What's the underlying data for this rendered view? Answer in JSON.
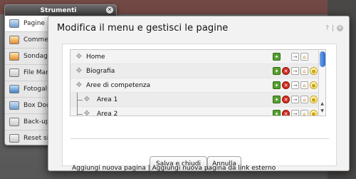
{
  "tools_window": {
    "title": "Strumenti",
    "items": [
      {
        "label": "Pagine",
        "icon": "pages-icon"
      },
      {
        "label": "Commenti",
        "icon": "comments-icon"
      },
      {
        "label": "Sondaggi",
        "icon": "polls-icon"
      },
      {
        "label": "File Manager",
        "icon": "file-manager-icon"
      },
      {
        "label": "Fotogallery",
        "icon": "photo-gallery-icon"
      },
      {
        "label": "Box Documenti",
        "icon": "documents-box-icon"
      },
      {
        "label": "Back-up e",
        "icon": "backup-icon"
      },
      {
        "label": "Reset sito",
        "icon": "reset-icon"
      }
    ]
  },
  "modal": {
    "title": "Modifica il menu e gestisci le pagine",
    "help": "?",
    "tree": [
      {
        "label": "Home",
        "level": 0
      },
      {
        "label": "Biografia",
        "level": 0
      },
      {
        "label": "Aree di competenza",
        "level": 0
      },
      {
        "label": "Area 1",
        "level": 1
      },
      {
        "label": "Area 2",
        "level": 1
      }
    ],
    "save_button": "Salva e chiudi",
    "cancel_button": "Annulla",
    "add_page_link": "Aggiungi nuova pagina",
    "link_separator": "|",
    "add_external_link": "Aggiungi nuova pagina da link esterno"
  },
  "colors": {
    "scroll_thumb": "#2f6bd0",
    "gear_action": "#58a030",
    "delete_action": "#d52b1e"
  }
}
